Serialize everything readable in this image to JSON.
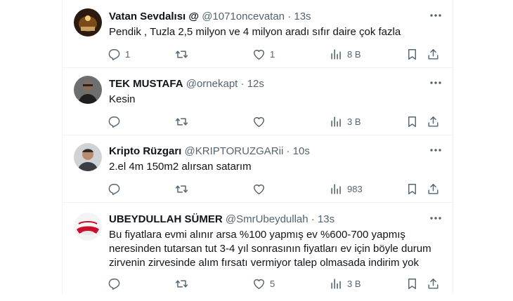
{
  "tweets": [
    {
      "name": "Vatan Sevdalısı @",
      "handle": "@1071oncevatan",
      "dot": "·",
      "time": "13s",
      "text": "Pendik , Tuzla 2,5 milyon ve 4 milyon aradı sıfır daire çok fazla",
      "replies": "1",
      "retweets": "",
      "likes": "1",
      "views": "8 B"
    },
    {
      "name": "TEK MUSTAFA",
      "handle": "@ornekapt",
      "dot": "·",
      "time": "12s",
      "text": "Kesin",
      "replies": "",
      "retweets": "",
      "likes": "",
      "views": "3 B"
    },
    {
      "name": "Kripto Rüzgarı",
      "handle": "@KRIPTORUZGARii",
      "dot": "·",
      "time": "10s",
      "text": "2.el 4m 150m2 alırsan satarım",
      "replies": "",
      "retweets": "",
      "likes": "",
      "views": "983"
    },
    {
      "name": "UBEYDULLAH SÜMER",
      "handle": "@SmrUbeydullah",
      "dot": "·",
      "time": "13s",
      "text": "Bu fiyatlara evmi alınır arsa %100 yapmış ev %600-700 yapmış neresinden tutarsan tut 3-4 yıl sonrasının fiyatları ev için böyle durum zirvenin zirvesinde alım fırsatı vermiyor talep olmasada indirim yok",
      "replies": "",
      "retweets": "",
      "likes": "5",
      "views": "3 B"
    }
  ],
  "icons": {
    "reply": "reply-icon",
    "retweet": "retweet-icon",
    "like": "heart-icon",
    "views": "views-icon",
    "bookmark": "bookmark-icon",
    "share": "share-icon",
    "more": "more-icon"
  },
  "colors": {
    "text": "#0f1419",
    "secondary": "#536471",
    "border": "#eff3f4"
  }
}
